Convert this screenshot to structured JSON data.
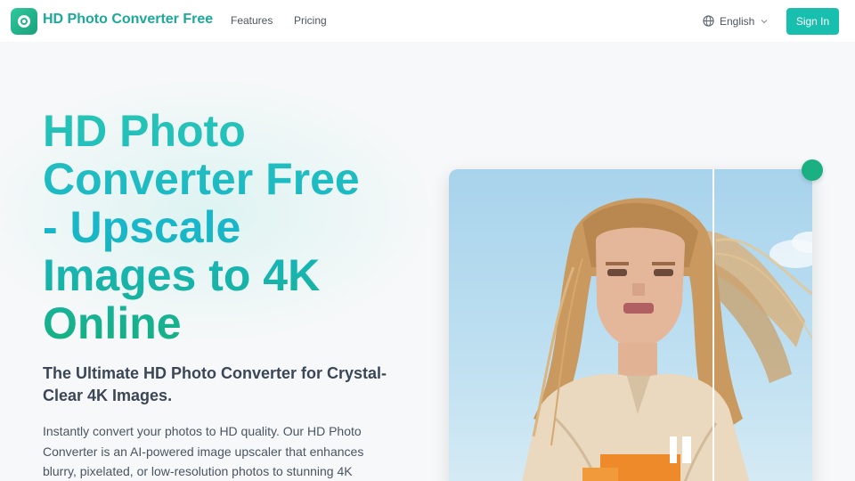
{
  "header": {
    "brand": "HD Photo Converter Free",
    "nav": [
      "Features",
      "Pricing"
    ],
    "language": "English",
    "sign_in": "Sign In"
  },
  "hero": {
    "title_lines": [
      "HD Photo",
      "Converter Free",
      "- Upscale",
      "Images to 4K",
      "Online"
    ],
    "subtitle": "The Ultimate HD Photo Converter for Crystal-Clear 4K Images.",
    "description": "Instantly convert your photos to HD quality. Our HD Photo Converter is an AI-powered image upscaler that enhances blurry, pixelated, or low-resolution photos to stunning 4K"
  },
  "icons": {
    "logo": "camera-lens-icon",
    "language": "globe-icon",
    "dropdown": "chevron-down-icon",
    "slider": "comparison-handle-icon"
  },
  "colors": {
    "brand": "#1ca89a",
    "button": "#19bfae",
    "title_gradient": [
      "#27c4b5",
      "#19b6cb",
      "#16b07f"
    ],
    "handle": "#1bb082"
  }
}
